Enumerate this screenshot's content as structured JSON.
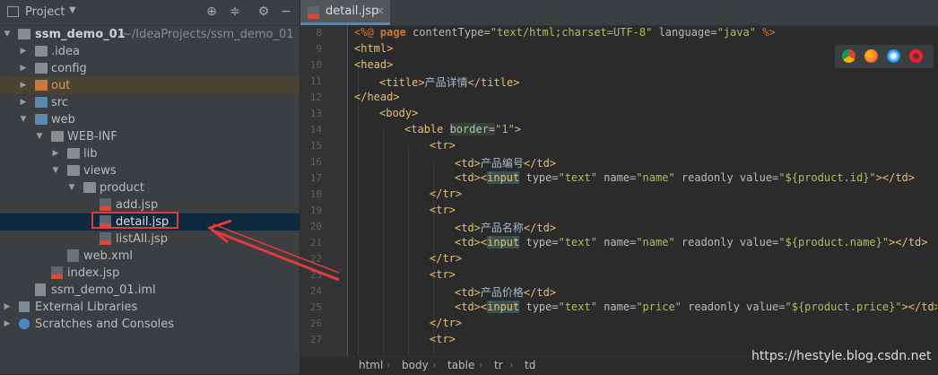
{
  "project": {
    "title": "Project",
    "tree": [
      {
        "label": "ssm_demo_01",
        "suffix": "~/IdeaProjects/ssm_demo_01"
      },
      {
        "label": ".idea"
      },
      {
        "label": "config"
      },
      {
        "label": "out"
      },
      {
        "label": "src"
      },
      {
        "label": "web"
      },
      {
        "label": "WEB-INF"
      },
      {
        "label": "lib"
      },
      {
        "label": "views"
      },
      {
        "label": "product"
      },
      {
        "label": "add.jsp"
      },
      {
        "label": "detail.jsp"
      },
      {
        "label": "listAll.jsp"
      },
      {
        "label": "web.xml"
      },
      {
        "label": "index.jsp"
      },
      {
        "label": "ssm_demo_01.iml"
      },
      {
        "label": "External Libraries"
      },
      {
        "label": "Scratches and Consoles"
      }
    ]
  },
  "editor": {
    "tab": "detail.jsp",
    "line_numbers": [
      "8",
      "9",
      "10",
      "11",
      "12",
      "13",
      "14",
      "15",
      "16",
      "17",
      "18",
      "19",
      "20",
      "21",
      "22",
      "23",
      "24",
      "25",
      "26",
      "27"
    ],
    "code": {
      "l8": {
        "a": "<%@ ",
        "b": "page ",
        "c": "contentType=",
        "d": "\"text/html;charset=UTF-8\"",
        "e": " language=",
        "f": "\"java\"",
        "g": " %>"
      },
      "l9": "<html>",
      "l10": "<head>",
      "l11": {
        "a": "<title>",
        "b": "产品详情",
        "c": "</title>"
      },
      "l12": "</head>",
      "l13": "<body>",
      "l14": {
        "a": "<table ",
        "b": "border=",
        "c": "\"1\"",
        "d": ">"
      },
      "l15": "<tr>",
      "l16": {
        "a": "<td>",
        "b": "产品编号",
        "c": "</td>"
      },
      "l17": {
        "a": "<td><",
        "b": "input",
        "c": " type=",
        "d": "\"text\"",
        "e": " name=",
        "f": "\"name\"",
        "g": " readonly value=",
        "h": "\"${product.id}\"",
        "i": "></td>"
      },
      "l18": "</tr>",
      "l19": "<tr>",
      "l20": {
        "a": "<td>",
        "b": "产品名称",
        "c": "</td>"
      },
      "l21": {
        "a": "<td><",
        "b": "input",
        "c": " type=",
        "d": "\"text\"",
        "e": " name=",
        "f": "\"name\"",
        "g": " readonly value=",
        "h": "\"${product.name}\"",
        "i": "></td>"
      },
      "l22": "</tr>",
      "l23": "<tr>",
      "l24": {
        "a": "<td>",
        "b": "产品价格",
        "c": "</td>"
      },
      "l25": {
        "a": "<td><",
        "b": "input",
        "c": " type=",
        "d": "\"text\"",
        "e": " name=",
        "f": "\"price\"",
        "g": " readonly value=",
        "h": "\"${product.price}\"",
        "i": "></td>"
      },
      "l26": "</tr>",
      "l27": "<tr>"
    },
    "breadcrumbs": [
      "html",
      "body",
      "table",
      "tr",
      "td"
    ]
  },
  "browsers": [
    "chrome-icon",
    "firefox-icon",
    "safari-icon",
    "opera-icon"
  ],
  "watermark": "https://hestyle.blog.csdn.net",
  "colors": {
    "selection": "#0d293e",
    "highlight_box": "#e23b3b",
    "tag": "#e8bf6a",
    "string": "#a5c25c",
    "keyword": "#cc7832"
  }
}
